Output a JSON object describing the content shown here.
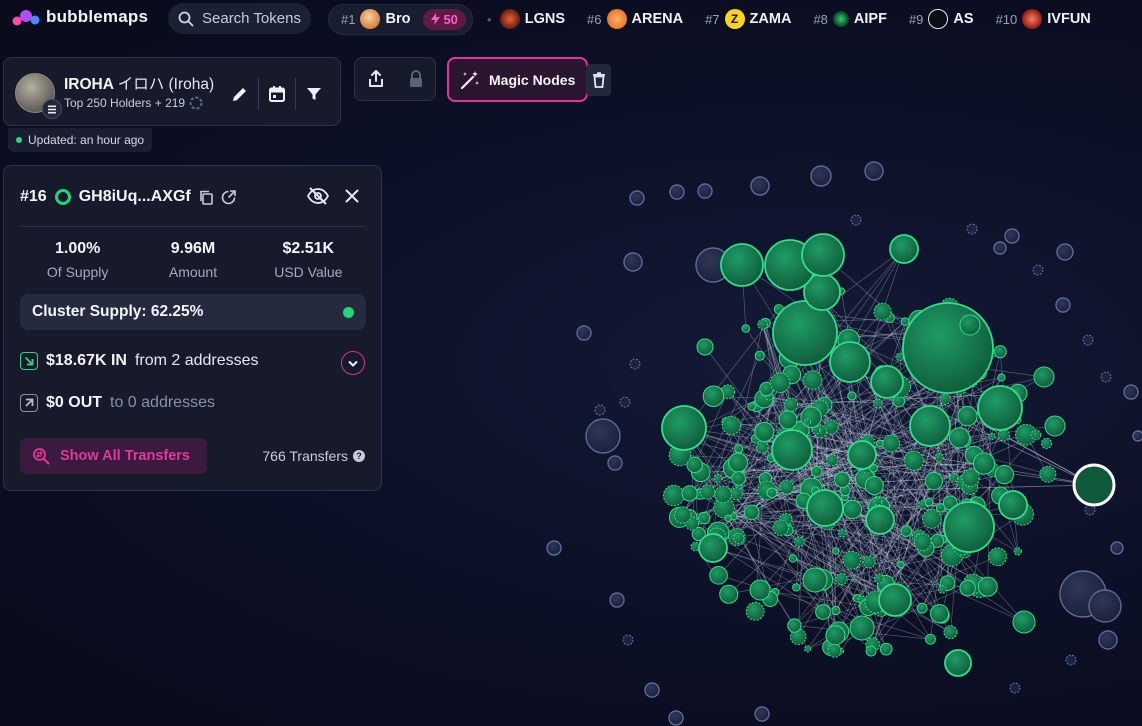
{
  "brand": {
    "name": "bubblemaps",
    "accent": "#e0359a",
    "node_green": "#1f9c64",
    "node_grey": "#2a3152"
  },
  "search": {
    "label": "Search Tokens"
  },
  "ticker": [
    {
      "rank": "#1",
      "symbol": "Bro",
      "boost": "50",
      "icon_color": "#d9803a"
    },
    {
      "rank": "",
      "symbol": "LGNS",
      "icon_color": "#a33a1f"
    },
    {
      "rank": "#6",
      "symbol": "ARENA",
      "icon_color": "#e7782c"
    },
    {
      "rank": "#7",
      "symbol": "ZAMA",
      "icon_color": "#ffd21e"
    },
    {
      "rank": "#8",
      "symbol": "AIPF",
      "icon_color": "#1c8a45"
    },
    {
      "rank": "#9",
      "symbol": "AS",
      "icon_color": "#e8e8e8"
    },
    {
      "rank": "#10",
      "symbol": "IVFUN",
      "icon_color": "#c0392b"
    }
  ],
  "token": {
    "name": "IROHA",
    "name_jp": "イロハ (Iroha)",
    "subtitle": "Top 250 Holders + 219",
    "updated": "Updated: an hour ago"
  },
  "toolbar": {
    "magic_nodes": "Magic Nodes"
  },
  "holder": {
    "rank": "#16",
    "address": "GH8iUq...AXGf",
    "stats": [
      {
        "value": "1.00%",
        "label": "Of Supply"
      },
      {
        "value": "9.96M",
        "label": "Amount"
      },
      {
        "value": "$2.51K",
        "label": "USD Value"
      }
    ],
    "cluster_supply": "Cluster Supply: 62.25%",
    "in_amount": "$18.67K IN",
    "in_text": "from 2 addresses",
    "out_amount": "$0 OUT",
    "out_text": "to 0 addresses",
    "show_transfers": "Show All Transfers",
    "transfer_count": "766 Transfers"
  }
}
